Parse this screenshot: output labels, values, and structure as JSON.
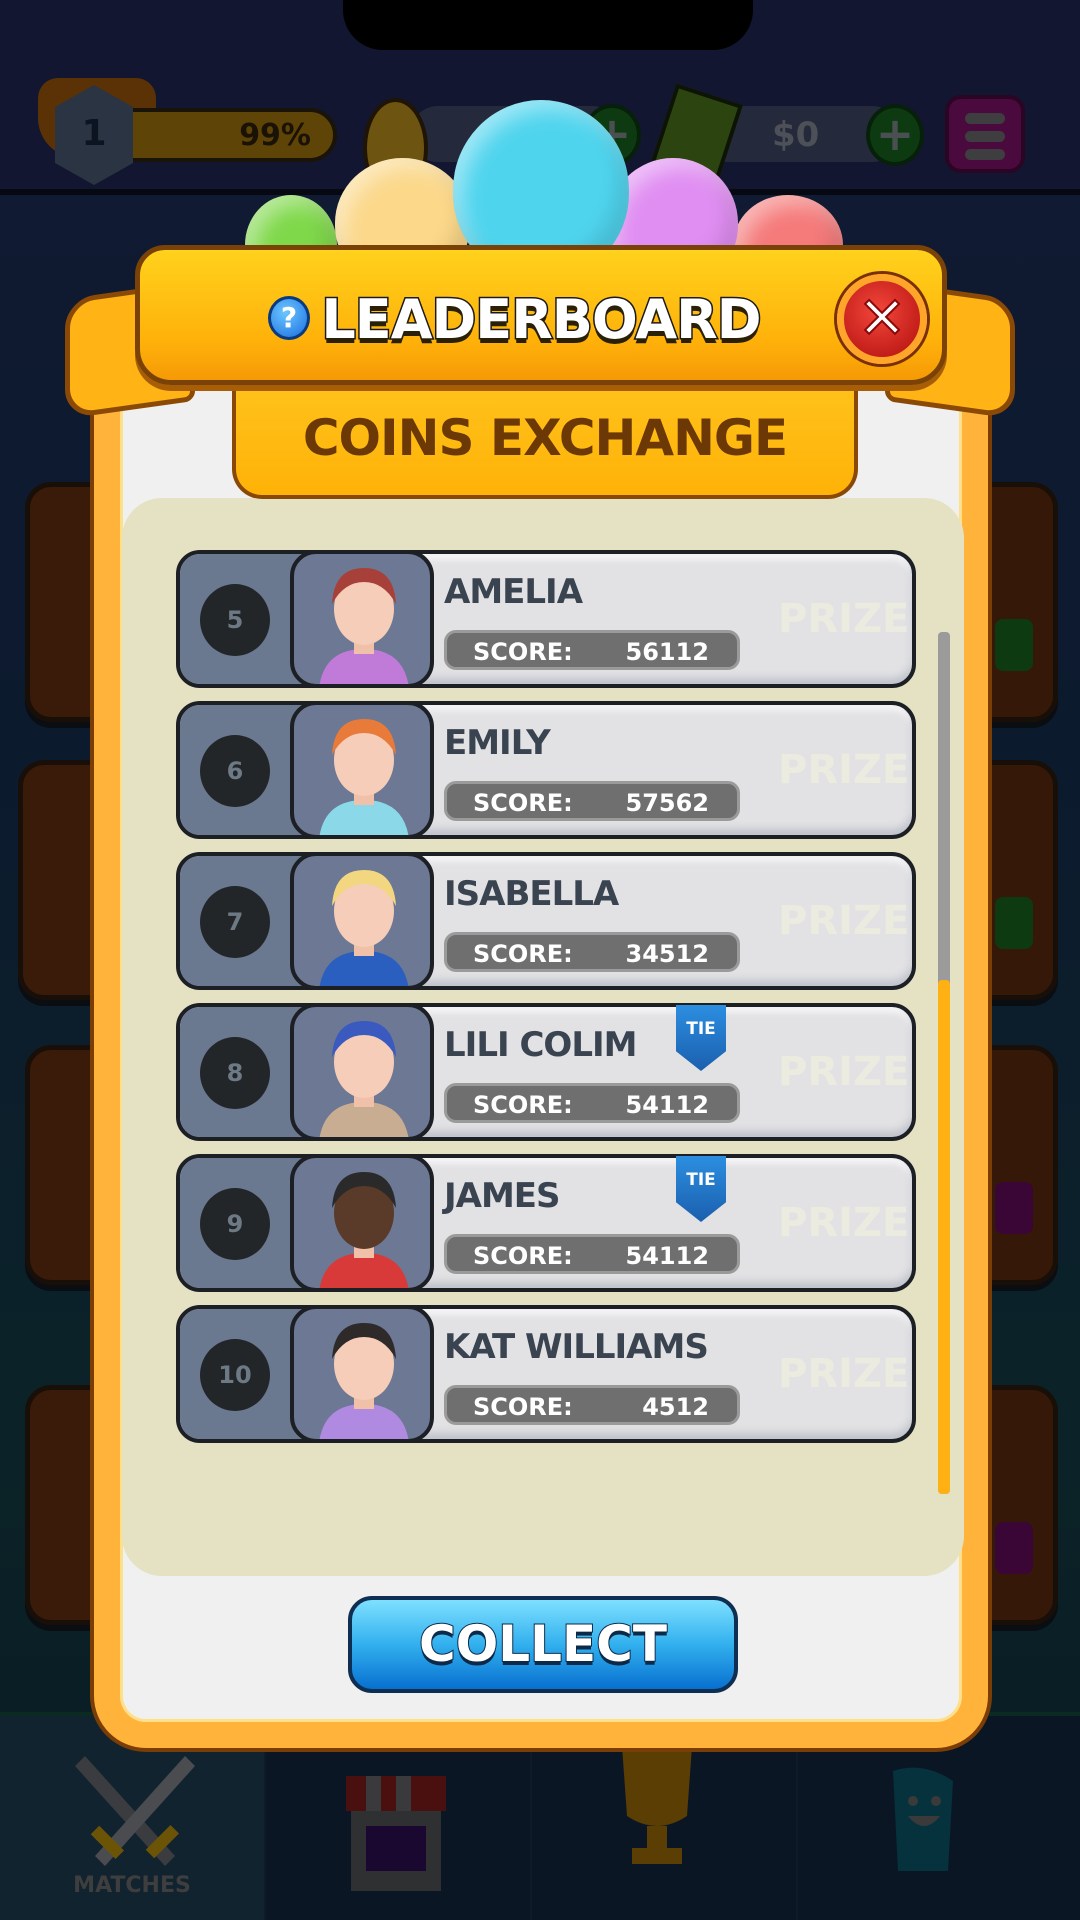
{
  "topbar": {
    "level": "1",
    "level_progress": "99%",
    "coins_value": "",
    "cash_value": "$0"
  },
  "modal": {
    "title": "LEADERBOARD",
    "tab_label": "COINS EXCHANGE",
    "score_label": "SCORE:",
    "prize_label": "PRIZE",
    "tie_label": "TIE",
    "collect_label": "COLLECT",
    "rows": [
      {
        "rank": "5",
        "name": "AMELIA",
        "score": "56112",
        "tie": false,
        "hair": "#a8403a",
        "shirt": "#c07ad8"
      },
      {
        "rank": "6",
        "name": "EMILY",
        "score": "57562",
        "tie": false,
        "hair": "#e87a3a",
        "shirt": "#8ad8e8"
      },
      {
        "rank": "7",
        "name": "ISABELLA",
        "score": "34512",
        "tie": false,
        "hair": "#f2d680",
        "shirt": "#2a5fc0"
      },
      {
        "rank": "8",
        "name": "LILI COLIM",
        "score": "54112",
        "tie": true,
        "hair": "#3a5ac0",
        "shirt": "#c8ad92"
      },
      {
        "rank": "9",
        "name": "JAMES",
        "score": "54112",
        "tie": true,
        "hair": "#2a2a2a",
        "shirt": "#d83a3a"
      },
      {
        "rank": "10",
        "name": "KAT WILLIAMS",
        "score": "4512",
        "tie": false,
        "hair": "#2e2a2a",
        "shirt": "#b08ae0"
      }
    ],
    "scroll_position": 0.4
  },
  "nav": {
    "items": [
      {
        "label": "MATCHES",
        "icon": "swords-icon"
      },
      {
        "label": "",
        "icon": "shop-icon"
      },
      {
        "label": "",
        "icon": "trophy-icon"
      },
      {
        "label": "",
        "icon": "profile-icon"
      }
    ]
  }
}
